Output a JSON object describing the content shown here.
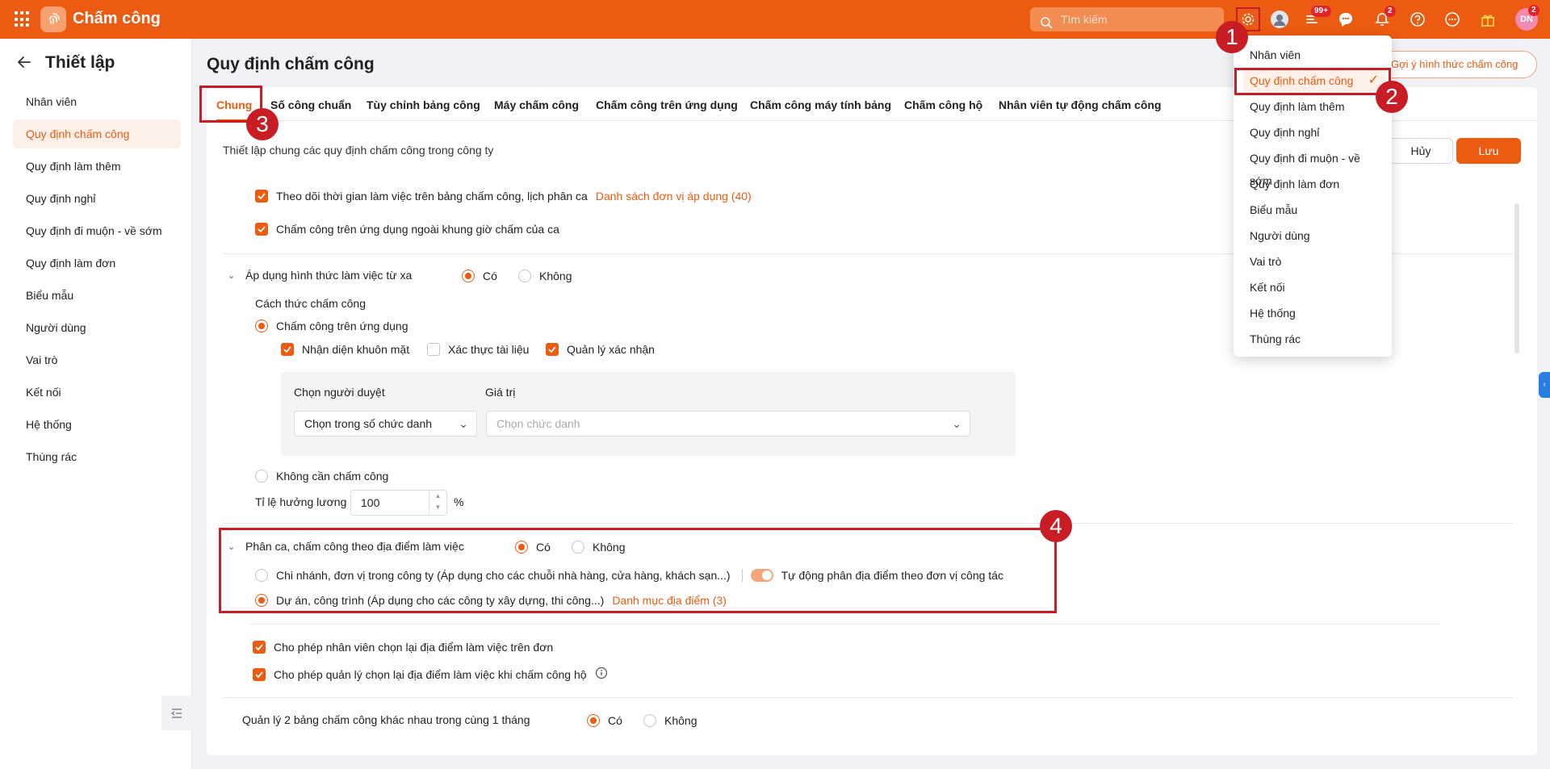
{
  "app": {
    "title": "Chấm công"
  },
  "topbar": {
    "search_placeholder": "Tìm kiếm",
    "badges": {
      "apps": "99+",
      "notifications": "2",
      "avatar": "2"
    },
    "avatar_initials": "DN"
  },
  "sidebar": {
    "title": "Thiết lập",
    "items": [
      {
        "label": "Nhân viên"
      },
      {
        "label": "Quy định chấm công"
      },
      {
        "label": "Quy định làm thêm"
      },
      {
        "label": "Quy định nghỉ"
      },
      {
        "label": "Quy định đi muộn - về sớm"
      },
      {
        "label": "Quy định làm đơn"
      },
      {
        "label": "Biểu mẫu"
      },
      {
        "label": "Người dùng"
      },
      {
        "label": "Vai trò"
      },
      {
        "label": "Kết nối"
      },
      {
        "label": "Hệ thống"
      },
      {
        "label": "Thùng rác"
      }
    ],
    "active_index": 1
  },
  "main": {
    "page_title": "Quy định chấm công",
    "hint_button": "Gợi ý hình thức chấm công",
    "tabs": [
      {
        "label": "Chung"
      },
      {
        "label": "Số công chuẩn"
      },
      {
        "label": "Tùy chỉnh bảng công"
      },
      {
        "label": "Máy chấm công"
      },
      {
        "label": "Chấm công trên ứng dụng"
      },
      {
        "label": "Chấm công máy tính bảng"
      },
      {
        "label": "Chấm công hộ"
      },
      {
        "label": "Nhân viên tự động chấm công"
      }
    ],
    "section_desc": "Thiết lập chung các quy định chấm công trong công ty",
    "cancel": "Hủy",
    "save": "Lưu",
    "opt_track_time": "Theo dõi thời gian làm việc trên bảng chấm công, lịch phân ca",
    "opt_track_link": "Danh sách đơn vị áp dụng (40)",
    "opt_outside_shift": "Chấm công trên ứng dụng ngoài khung giờ chấm của ca",
    "remote_label": "Áp dụng hình thức làm việc từ xa",
    "yes": "Có",
    "no": "Không",
    "method_title": "Cách thức chấm công",
    "method_app": "Chấm công trên ứng dụng",
    "face_id": "Nhận diện khuôn mặt",
    "doc_verify": "Xác thực tài liệu",
    "manager_confirm": "Quản lý xác nhận",
    "approver_label": "Chọn người duyệt",
    "value_label": "Giá trị",
    "approver_select": "Chọn trong số chức danh",
    "value_placeholder": "Chọn chức danh",
    "no_timekeeping": "Không cần chấm công",
    "salary_ratio_label": "Tỉ lệ hưởng lương",
    "salary_ratio_value": "100",
    "percent": "%",
    "location_label": "Phân ca, chấm công theo địa điểm làm việc",
    "branch_option": "Chi nhánh, đơn vị trong công ty (Áp dụng cho các chuỗi nhà hàng, cửa hàng, khách sạn...)",
    "auto_assign": "Tự động phân địa điểm theo đơn vị công tác",
    "project_option": "Dự án, công trình (Áp dụng cho các công ty xây dựng, thi công...)",
    "project_link": "Danh mục địa điểm (3)",
    "allow_employee": "Cho phép nhân viên chọn lại địa điểm làm việc trên đơn",
    "allow_manager": "Cho phép quản lý chọn lại địa điểm làm việc khi chấm công hộ",
    "two_tables": "Quản lý 2 bảng chấm công khác nhau trong cùng 1 tháng"
  },
  "dropdown": {
    "items": [
      {
        "label": "Nhân viên"
      },
      {
        "label": "Quy định chấm công"
      },
      {
        "label": "Quy định làm thêm"
      },
      {
        "label": "Quy định nghỉ"
      },
      {
        "label": "Quy định đi muộn - về sớm"
      },
      {
        "label": "Quy định làm đơn"
      },
      {
        "label": "Biểu mẫu"
      },
      {
        "label": "Người dùng"
      },
      {
        "label": "Vai trò"
      },
      {
        "label": "Kết nối"
      },
      {
        "label": "Hệ thống"
      },
      {
        "label": "Thùng rác"
      }
    ],
    "selected_index": 1
  },
  "annotations": [
    "1",
    "2",
    "3",
    "4"
  ],
  "colors": {
    "brand": "#eb5b11",
    "annotation": "#c81d25"
  }
}
